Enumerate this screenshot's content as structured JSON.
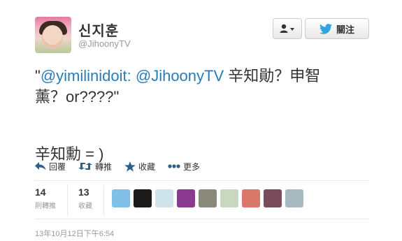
{
  "profile": {
    "name": "신지훈",
    "handle": "@JihoonyTV"
  },
  "buttons": {
    "follow_label": "關注"
  },
  "tweet": {
    "quote_open": "\"",
    "mention1": "@yimilinidoit:",
    "mention2": "@JihoonyTV",
    "text1": " 辛知勛？申智",
    "text2": "薰？or????\"",
    "line2": "辛知勳 = )"
  },
  "actions": {
    "reply": "回覆",
    "retweet": "轉推",
    "favorite": "收藏",
    "more": "更多"
  },
  "stats": {
    "retweets": {
      "num": "14",
      "label": "則轉推"
    },
    "favorites": {
      "num": "13",
      "label": "收藏"
    }
  },
  "faces": [
    {
      "name": "face-1",
      "color": "#7fbfe8"
    },
    {
      "name": "face-2",
      "color": "#1a1a1a"
    },
    {
      "name": "face-3",
      "color": "#cfe3ea"
    },
    {
      "name": "face-4",
      "color": "#8a3b8f"
    },
    {
      "name": "face-5",
      "color": "#8a8a7a"
    },
    {
      "name": "face-6",
      "color": "#c9d6c0"
    },
    {
      "name": "face-7",
      "color": "#d9776b"
    },
    {
      "name": "face-8",
      "color": "#7a4b5a"
    },
    {
      "name": "face-9",
      "color": "#a9b9c0"
    }
  ],
  "timestamp": "13年10月12日下午6:54",
  "colors": {
    "link": "#2b7bb9",
    "twitter_blue": "#2ea5e0",
    "muted": "#999999"
  }
}
